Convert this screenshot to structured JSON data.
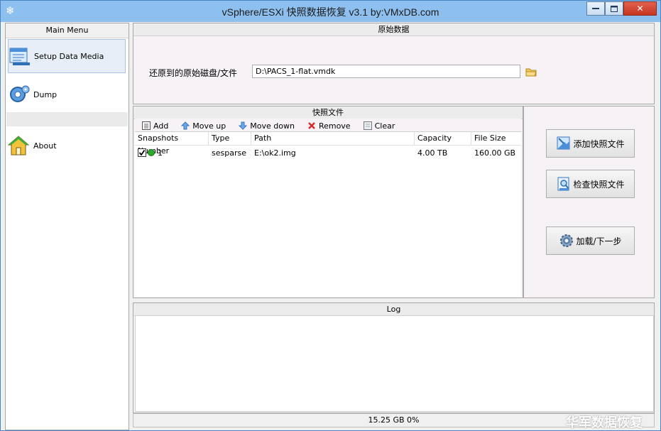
{
  "window": {
    "title": "vSphere/ESXi 快照数据恢复 v3.1 by:VMxDB.com",
    "minimize": "▬",
    "maximize": "▢",
    "close": "✕"
  },
  "sidebar": {
    "header": "Main Menu",
    "items": [
      {
        "label": "Setup Data Media",
        "icon": "data-media-icon",
        "selected": true
      },
      {
        "label": "Dump",
        "icon": "gear-icon",
        "selected": false
      },
      {
        "label": "About",
        "icon": "house-icon",
        "selected": false
      }
    ]
  },
  "original": {
    "header": "原始数据",
    "label": "还原到的原始磁盘/文件",
    "path_value": "D:\\PACS_1-flat.vmdk"
  },
  "snapshots": {
    "header": "快照文件",
    "toolbar": {
      "add": "Add",
      "move_up": "Move up",
      "move_down": "Move down",
      "remove": "Remove",
      "clear": "Clear"
    },
    "columns": [
      "Snapshots Number",
      "Type",
      "Path",
      "Capacity",
      "File Size"
    ],
    "rows": [
      {
        "number": "1",
        "type": "sesparse",
        "path": "E:\\ok2.img",
        "capacity": "4.00 TB",
        "file_size": "160.00 GB",
        "checked": true
      }
    ]
  },
  "actions": {
    "add_snapshot": "添加快照文件",
    "check_snapshot": "检查快照文件",
    "load_next": "加载/下一步"
  },
  "log": {
    "header": "Log"
  },
  "status": {
    "text": "15.25 GB  0%"
  },
  "watermark": "华军数据恢复",
  "colors": {
    "titlebar": "#8ec0ef",
    "status_dot": "#2ca82c",
    "remove_red": "#d62b2b",
    "arrow_blue": "#4a8fd8"
  }
}
